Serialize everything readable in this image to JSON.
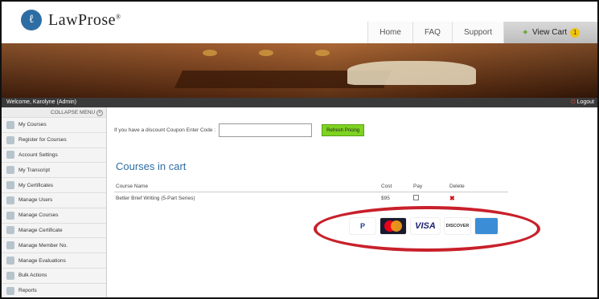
{
  "header": {
    "brand": "LawProse",
    "brand_mark": "®",
    "nav": [
      "Home",
      "FAQ",
      "Support"
    ],
    "cart_label": "View Cart",
    "cart_count": "1"
  },
  "welcome": {
    "text": "Welcome, Karolyne (Admin)",
    "logout_label": "Logout"
  },
  "sidebar": {
    "collapse_label": "COLLAPSE MENU",
    "items": [
      {
        "label": "My Courses"
      },
      {
        "label": "Register for Courses"
      },
      {
        "label": "Account Settings"
      },
      {
        "label": "My Transcript"
      },
      {
        "label": "My Certificates"
      },
      {
        "label": "Manage Users"
      },
      {
        "label": "Manage Courses"
      },
      {
        "label": "Manage Certificate"
      },
      {
        "label": "Manage Member No."
      },
      {
        "label": "Manage Evaluations"
      },
      {
        "label": "Bulk Actions"
      },
      {
        "label": "Reports"
      }
    ]
  },
  "main": {
    "coupon_label": "If you have a discount Coupon Enter Code :",
    "coupon_value": "",
    "refresh_label": "Refresh Pricing",
    "cart_title": "Courses in cart",
    "table": {
      "headers": [
        "Course Name",
        "Cost",
        "Pay",
        "Delete"
      ],
      "rows": [
        {
          "name": "Better Brief Writing (5-Part Series)",
          "cost": "$95",
          "pay": false,
          "delete": "✖"
        }
      ]
    }
  },
  "payments": {
    "paypal": "P",
    "paypal_sub": "PayPal",
    "visa": "VISA",
    "discover": "DISCOVER",
    "amex": "AMERICAN EXPRESS"
  },
  "colors": {
    "accent_blue": "#2e6da4",
    "refresh_green": "#7ed321",
    "highlight_red": "#c8202a"
  }
}
